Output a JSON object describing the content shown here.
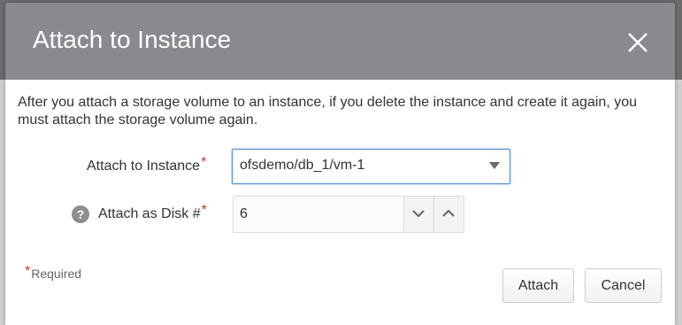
{
  "dialog": {
    "title": "Attach to Instance",
    "intro": "After you attach a storage volume to an instance, if you delete the instance and create it again, you must attach the storage volume again."
  },
  "fields": {
    "instance": {
      "label": "Attach to Instance",
      "required_marker": "*",
      "value": "ofsdemo/db_1/vm-1"
    },
    "disk": {
      "label": "Attach as Disk #",
      "required_marker": "*",
      "value": "6",
      "help_glyph": "?"
    }
  },
  "footer": {
    "required_marker": "*",
    "required_label": "Required",
    "attach_label": "Attach",
    "cancel_label": "Cancel"
  },
  "icons": {
    "close": "close-icon",
    "caret": "caret-down-icon",
    "decrement": "chevron-down-icon",
    "increment": "chevron-up-icon",
    "help": "help-icon"
  },
  "colors": {
    "header_bg": "#8a898f",
    "required_star": "#c0392b",
    "focus_border": "#4b8ed0"
  }
}
